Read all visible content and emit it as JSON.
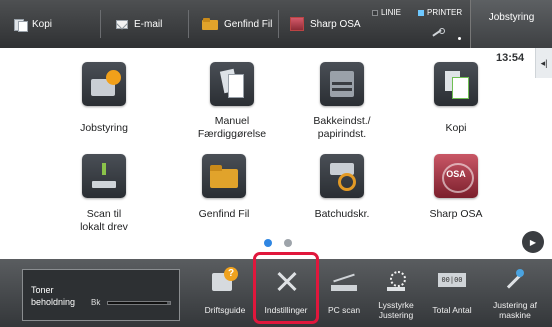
{
  "topbar": {
    "tabs": [
      {
        "label": "Kopi",
        "icon": "copy-icon"
      },
      {
        "label": "E-mail",
        "icon": "mail-icon"
      },
      {
        "label": "Genfind Fil",
        "icon": "folder-icon"
      },
      {
        "label": "Sharp OSA",
        "icon": "osa-icon"
      }
    ],
    "status": {
      "line_label": "LINIE",
      "printer_label": "PRINTER"
    },
    "job_status_label": "Jobstyring",
    "clock": "13:54",
    "colors": {
      "printer_indicator": "#6ec8ff"
    }
  },
  "home": {
    "tiles": [
      {
        "label": "Jobstyring",
        "icon": "job-status-icon"
      },
      {
        "label": "Manuel\nFærdiggørelse",
        "icon": "manual-finishing-icon"
      },
      {
        "label": "Bakkeindst./\npapirindst.",
        "icon": "tray-settings-icon"
      },
      {
        "label": "Kopi",
        "icon": "copy-icon"
      },
      {
        "label": "Scan til\nlokalt drev",
        "icon": "scan-to-local-drive-icon"
      },
      {
        "label": "Genfind Fil",
        "icon": "file-retrieve-icon"
      },
      {
        "label": "Batchudskr.",
        "icon": "batch-print-icon"
      },
      {
        "label": "Sharp OSA",
        "icon": "sharp-osa-icon"
      }
    ],
    "pager": {
      "current_page": 1,
      "total_pages": 2
    },
    "colors": {
      "active_dot": "#2f86e2"
    }
  },
  "bottom": {
    "toner": {
      "label": "Toner\nbeholdning",
      "bk_label": "Bk",
      "bk_level": 0.95
    },
    "menu": [
      {
        "label": "Driftsguide",
        "icon": "operation-guide-icon"
      },
      {
        "label": "Indstillinger",
        "icon": "settings-icon"
      },
      {
        "label": "PC scan",
        "icon": "pc-scan-icon"
      },
      {
        "label": "Lysstyrke\nJustering",
        "icon": "brightness-icon"
      },
      {
        "label": "Total Antal",
        "icon": "total-count-icon"
      },
      {
        "label": "Justering af\nmaskine",
        "icon": "machine-adjust-icon"
      }
    ],
    "highlight_color": "#e0173c"
  }
}
